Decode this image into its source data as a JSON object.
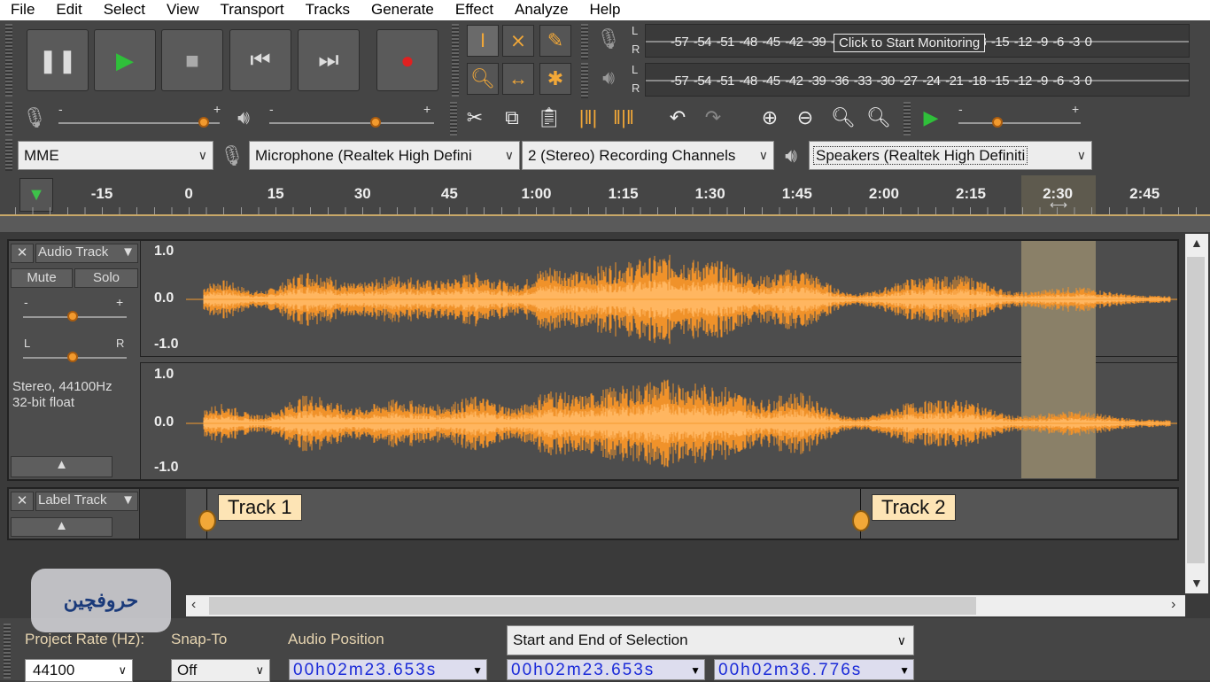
{
  "menu": [
    "File",
    "Edit",
    "Select",
    "View",
    "Transport",
    "Tracks",
    "Generate",
    "Effect",
    "Analyze",
    "Help"
  ],
  "transport": {
    "pause": "pause-icon",
    "play": "play-icon",
    "stop": "stop-icon",
    "skip_start": "skip-start-icon",
    "skip_end": "skip-end-icon",
    "record": "record-icon"
  },
  "meters": {
    "scale": "-57 -54 -51 -48 -45 -42 -39 -36 -33 -30 -27 -24 -21 -18 -15 -12 -9 -6 -3 0",
    "monitor_tooltip": "Click to Start Monitoring",
    "L": "L",
    "R": "R"
  },
  "mixer": {
    "minus": "-",
    "plus": "+",
    "recording_volume": 0.88,
    "playback_volume": 0.65,
    "play_speed": 0.3
  },
  "devices": {
    "host": "MME",
    "input": "Microphone (Realtek High Defini",
    "channels": "2 (Stereo) Recording Channels",
    "output": "Speakers (Realtek High Definiti"
  },
  "timeline": {
    "ticks": [
      "-15",
      "0",
      "15",
      "30",
      "45",
      "1:00",
      "1:15",
      "1:30",
      "1:45",
      "2:00",
      "2:15",
      "2:30",
      "2:45"
    ]
  },
  "audio_track": {
    "name": "Audio Track",
    "mute": "Mute",
    "solo": "Solo",
    "gain_minus": "-",
    "gain_plus": "+",
    "pan_left": "L",
    "pan_right": "R",
    "info1": "Stereo, 44100Hz",
    "info2": "32-bit float",
    "y_top": "1.0",
    "y_mid": "0.0",
    "y_bot": "-1.0",
    "wave_color": "#f59a2e",
    "selection_color": "#8a8068"
  },
  "label_track": {
    "name": "Label Track",
    "labels": [
      {
        "text": "Track 1",
        "time": "0:02"
      },
      {
        "text": "Track 2",
        "time": "1:55"
      }
    ]
  },
  "watermark": {
    "text": "حروفچین"
  },
  "selection_bar": {
    "project_rate_label": "Project Rate (Hz):",
    "project_rate": "44100",
    "snap_label": "Snap-To",
    "snap": "Off",
    "audio_position_label": "Audio Position",
    "audio_position": "00h02m23.653s",
    "selection_mode": "Start and End of Selection",
    "selection_start": "00h02m23.653s",
    "selection_end": "00h02m36.776s"
  }
}
